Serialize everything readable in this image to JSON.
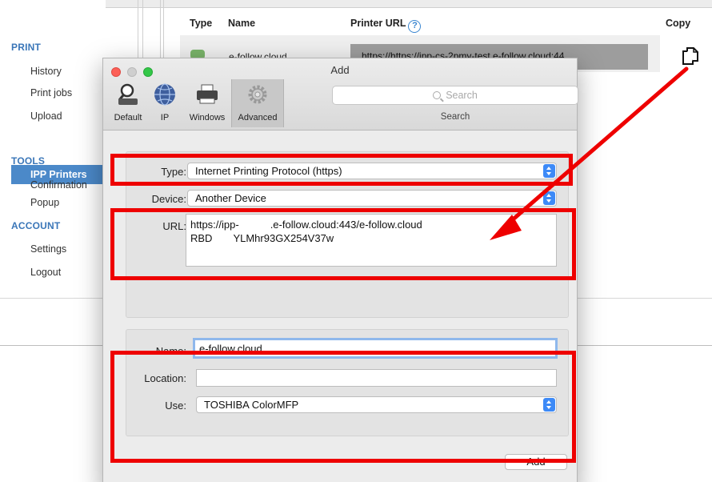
{
  "sidebar": {
    "sections": [
      {
        "title": "PRINT",
        "items": [
          "History",
          "Print jobs",
          "Upload",
          "IPP Printers"
        ]
      },
      {
        "title": "TOOLS",
        "items": [
          "Confirmation",
          "Popup"
        ]
      },
      {
        "title": "ACCOUNT",
        "items": [
          "Settings",
          "Logout"
        ]
      }
    ],
    "active_item": "IPP Printers"
  },
  "table": {
    "headers": {
      "type": "Type",
      "name": "Name",
      "printer_url": "Printer URL",
      "copy": "Copy"
    },
    "row": {
      "name": "e-follow.cloud",
      "url": "https://https://ipp-cs-2pmy-test.e-follow.cloud:44"
    }
  },
  "dialog": {
    "title": "Add",
    "toolbar": [
      {
        "label": "Default",
        "icon": "printer-magnifier-icon"
      },
      {
        "label": "IP",
        "icon": "globe-icon"
      },
      {
        "label": "Windows",
        "icon": "printer-icon"
      },
      {
        "label": "Advanced",
        "icon": "gear-icon"
      }
    ],
    "active_tab": "Advanced",
    "search": {
      "placeholder": "Search",
      "caption": "Search"
    },
    "form": {
      "type_label": "Type:",
      "type_value": "Internet Printing Protocol (https)",
      "device_label": "Device:",
      "device_value": "Another Device",
      "url_label": "URL:",
      "url_line1": "https://ipp-   .e-follow.cloud:443/e-follow.cloud",
      "url_line2": "RBD  YLMhr93GX254V37w",
      "name_label": "Name:",
      "name_value": "e-follow.cloud",
      "location_label": "Location:",
      "location_value": "",
      "use_label": "Use:",
      "use_value": "TOSHIBA ColorMFP"
    },
    "add_button": "Add"
  },
  "colors": {
    "highlight": "#ee0000",
    "sidebar_active": "#4b89c9",
    "accent_blue": "#3d8af7"
  }
}
